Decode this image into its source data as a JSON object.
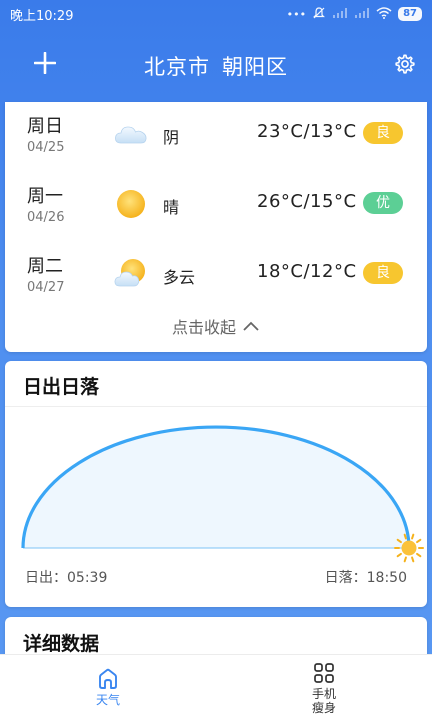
{
  "status_bar": {
    "time": "晚上10:29",
    "battery": "87"
  },
  "header": {
    "title_city": "北京市",
    "title_district": "朝阳区"
  },
  "forecast": {
    "days": [
      {
        "day": "周日",
        "date": "04/25",
        "icon": "cloudy-icon",
        "condition": "阴",
        "temp": "23°C/13°C",
        "aqi": "良",
        "aqi_color": "#f7c62f"
      },
      {
        "day": "周一",
        "date": "04/26",
        "icon": "sunny-icon",
        "condition": "晴",
        "temp": "26°C/15°C",
        "aqi": "优",
        "aqi_color": "#5ccf95"
      },
      {
        "day": "周二",
        "date": "04/27",
        "icon": "partly-cloudy-icon",
        "condition": "多云",
        "temp": "18°C/12°C",
        "aqi": "良",
        "aqi_color": "#f7c62f"
      }
    ],
    "collapse_label": "点击收起"
  },
  "sun": {
    "title": "日出日落",
    "sunrise_label": "日出：05:39",
    "sunset_label": "日落：18:50",
    "progress": 1.0,
    "arc_color": "#3aa6f5",
    "fill_color": "#eef7fe"
  },
  "detail": {
    "title": "详细数据"
  },
  "tabs": {
    "weather": "天气",
    "slim_line1": "手机",
    "slim_line2": "瘦身"
  },
  "colors": {
    "accent": "#3a86f0",
    "header_gradient_top": "#3a7bea"
  }
}
